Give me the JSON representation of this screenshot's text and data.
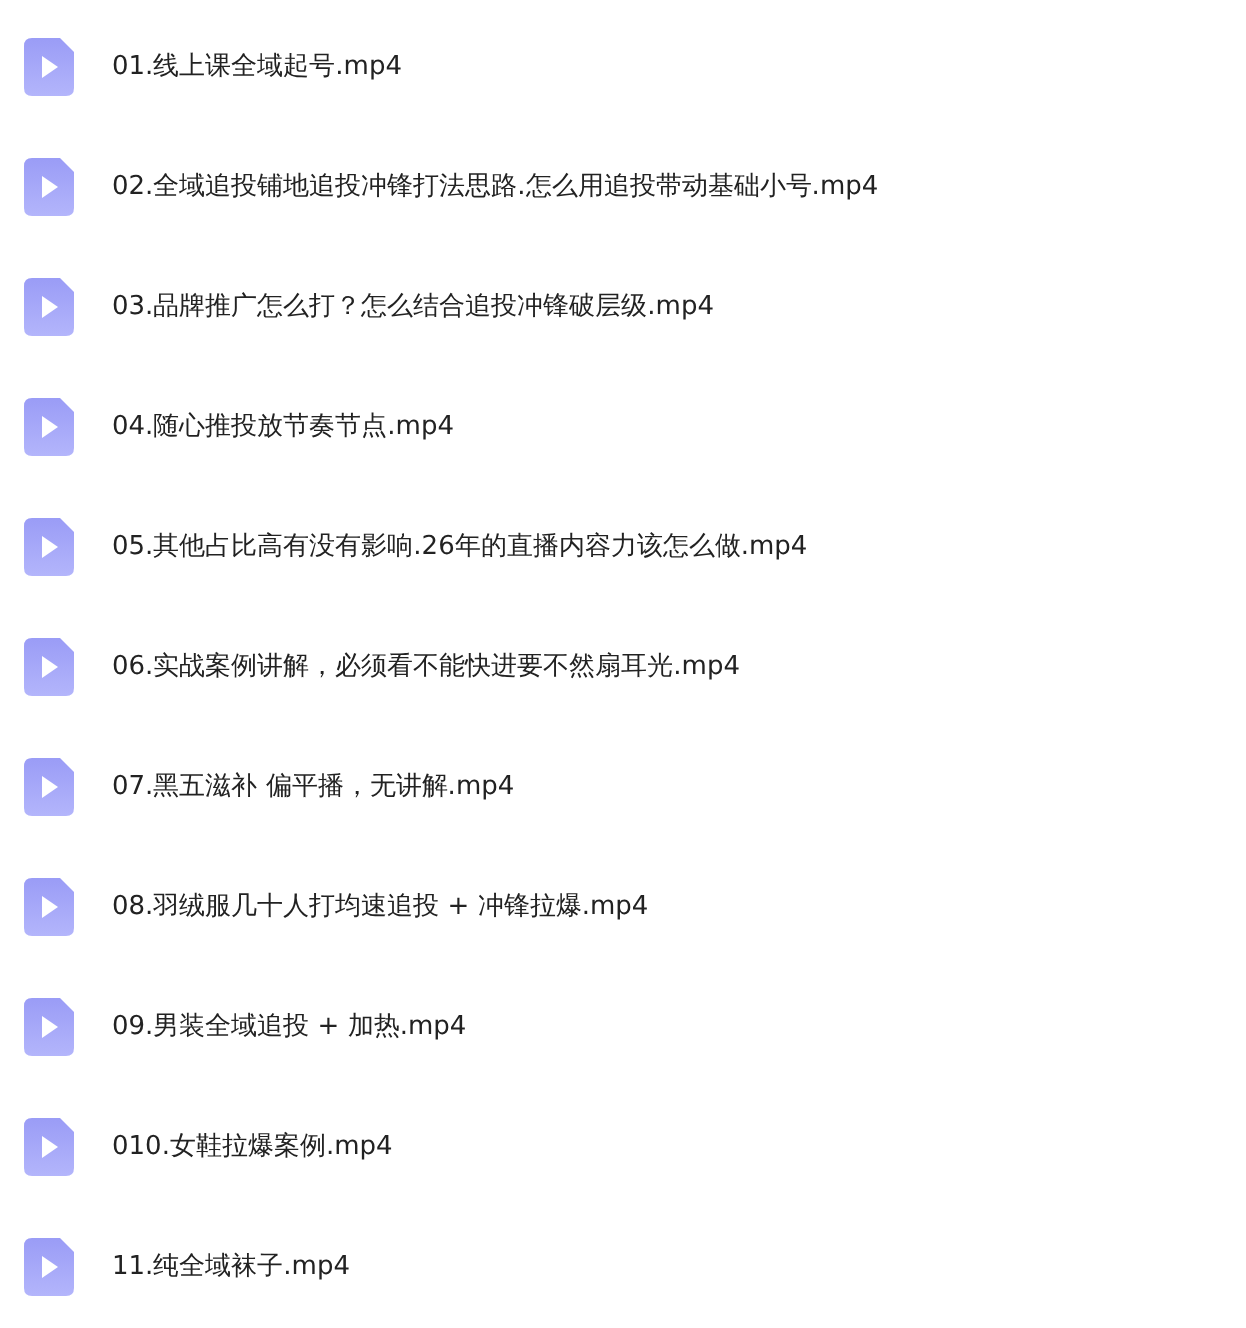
{
  "files": [
    {
      "name": "01.线上课全域起号.mp4"
    },
    {
      "name": "02.全域追投铺地追投冲锋打法思路.怎么用追投带动基础小号.mp4"
    },
    {
      "name": "03.品牌推广怎么打？怎么结合追投冲锋破层级.mp4"
    },
    {
      "name": "04.随心推投放节奏节点.mp4"
    },
    {
      "name": "05.其他占比高有没有影响.26年的直播内容力该怎么做.mp4"
    },
    {
      "name": "06.实战案例讲解，必须看不能快进要不然扇耳光.mp4"
    },
    {
      "name": "07.黑五滋补 偏平播，无讲解.mp4"
    },
    {
      "name": "08.羽绒服几十人打均速追投 + 冲锋拉爆.mp4"
    },
    {
      "name": "09.男装全域追投 + 加热.mp4"
    },
    {
      "name": "010.女鞋拉爆案例.mp4"
    },
    {
      "name": "11.纯全域袜子.mp4"
    }
  ]
}
